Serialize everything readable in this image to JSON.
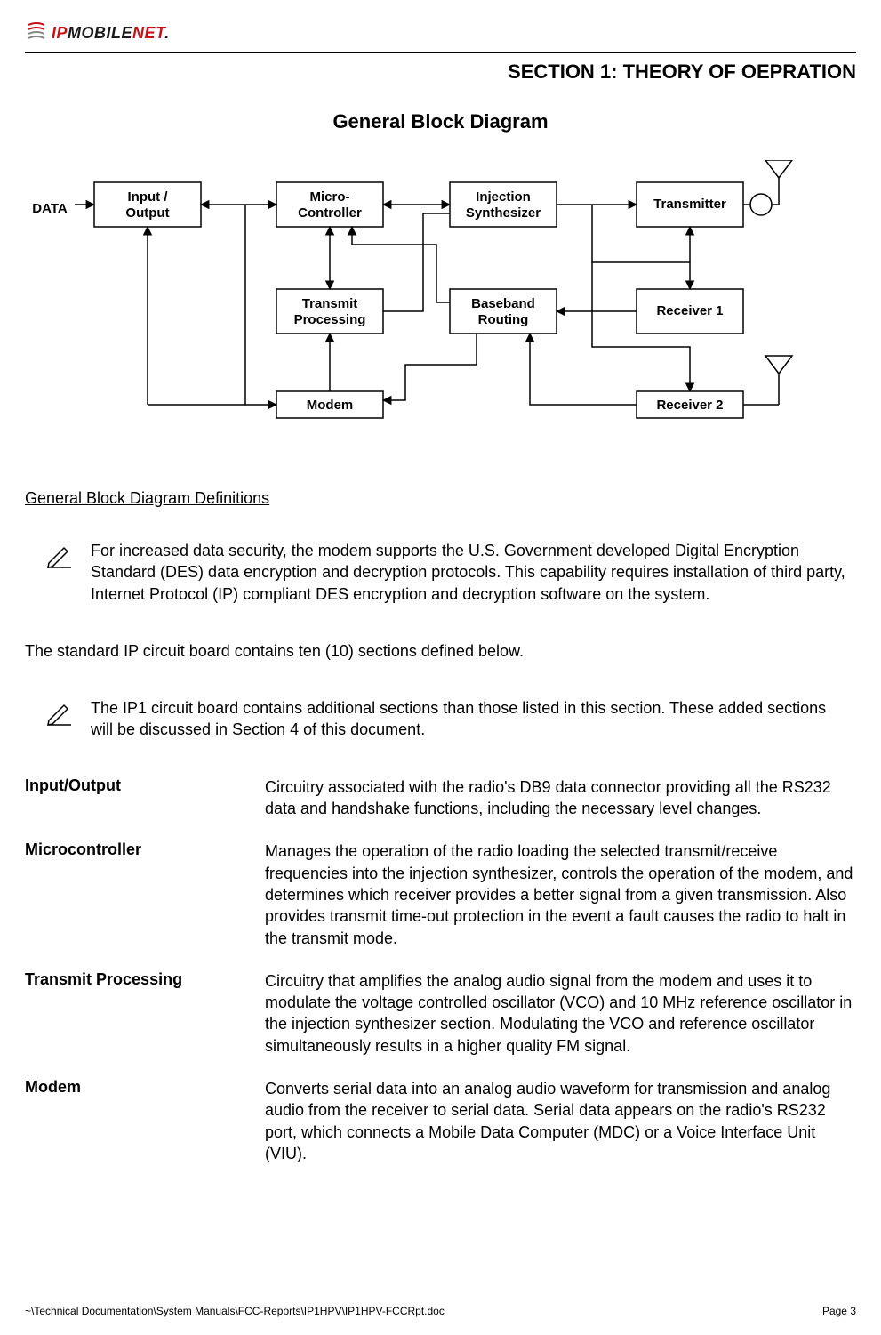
{
  "logo": {
    "ip": "IP",
    "mobile": "MOBILE",
    "net": "NET",
    "dot": "."
  },
  "header": {
    "section_title": "SECTION 1:  THEORY OF OEPRATION"
  },
  "diagram": {
    "title": "General Block Diagram",
    "data_label": "DATA",
    "boxes": {
      "input_output_l1": "Input /",
      "input_output_l2": "Output",
      "micro_l1": "Micro-",
      "micro_l2": "Controller",
      "injection_l1": "Injection",
      "injection_l2": "Synthesizer",
      "transmitter": "Transmitter",
      "tx_proc_l1": "Transmit",
      "tx_proc_l2": "Processing",
      "baseband_l1": "Baseband",
      "baseband_l2": "Routing",
      "receiver1": "Receiver 1",
      "modem": "Modem",
      "receiver2": "Receiver 2"
    }
  },
  "definitions_heading": "General Block Diagram Definitions",
  "note1": "For increased data security, the modem supports the U.S. Government developed Digital Encryption Standard (DES) data encryption and decryption protocols.  This capability requires installation of third party, Internet Protocol (IP) compliant DES encryption and decryption software on the system.",
  "body1": "The standard IP circuit board contains ten (10) sections defined below.",
  "note2": "The IP1 circuit board contains additional sections than those listed in this section.  These added sections will be discussed in Section 4 of this document.",
  "defs": {
    "io": {
      "term": "Input/Output",
      "desc": "Circuitry associated with the radio's DB9 data connector providing all the RS232 data and handshake functions, including the necessary level changes."
    },
    "mc": {
      "term": "Microcontroller",
      "desc": "Manages the operation of the radio loading the selected transmit/receive frequencies into the injection synthesizer, controls the operation of the modem, and determines which receiver provides a better signal from a given transmission.  Also provides transmit time-out protection in the event a fault causes the radio to halt in the transmit mode."
    },
    "tp": {
      "term": "Transmit Processing",
      "desc": "Circuitry that amplifies the analog audio signal from the modem and uses it to modulate the voltage controlled oscillator (VCO) and 10 MHz reference oscillator in the injection synthesizer section.  Modulating the VCO and reference oscillator simultaneously results in a higher quality FM signal."
    },
    "modem": {
      "term": "Modem",
      "desc": "Converts serial data into an analog audio waveform for transmission and analog audio from the receiver to serial data.  Serial data appears on the radio's RS232 port, which connects a Mobile Data Computer (MDC) or a Voice Interface Unit (VIU)."
    }
  },
  "footer": {
    "path": "~\\Technical Documentation\\System Manuals\\FCC-Reports\\IP1HPV\\IP1HPV-FCCRpt.doc",
    "page": "Page 3"
  }
}
